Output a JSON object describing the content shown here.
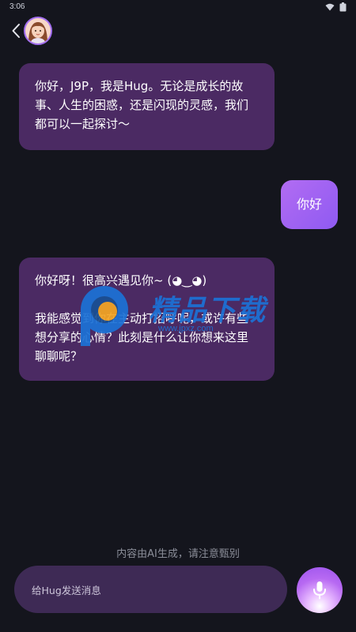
{
  "status_bar": {
    "time": "3:06",
    "wifi_icon": "wifi-icon",
    "battery_icon": "battery-icon"
  },
  "header": {
    "back_icon": "chevron-left-icon",
    "avatar_icon": "avatar-girl-icon",
    "accent_color": "#a36ff0"
  },
  "messages": [
    {
      "sender": "ai",
      "text": "你好，J9P，我是Hug。无论是成长的故事、人生的困惑，还是闪现的灵感，我们都可以一起探讨～"
    },
    {
      "sender": "user",
      "text": "你好"
    },
    {
      "sender": "ai",
      "text": "你好呀！很高兴遇见你~ (◕‿◕)\n\n我能感觉到你在主动打招呼呢，或许有些想分享的心情？此刻是什么让你想来这里聊聊呢？"
    }
  ],
  "watermark": {
    "title": "精品下载",
    "url": "www.jpxz.com"
  },
  "disclaimer": "内容由AI生成，请注意甄别",
  "input": {
    "placeholder": "给Hug发送消息"
  },
  "mic_icon": "microphone-icon",
  "colors": {
    "background": "#14151d",
    "ai_bubble": "#4b2a63",
    "user_bubble": "#b26cf2",
    "input_bar": "#3e2a55",
    "watermark_blue": "#1c72d6",
    "watermark_orange": "#f5a623"
  }
}
